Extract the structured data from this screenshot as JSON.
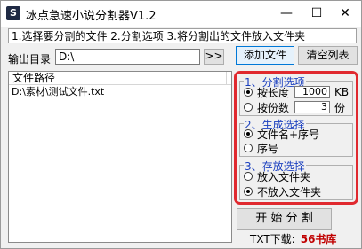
{
  "window": {
    "title": "冰点急速小说分割器V1.2",
    "icon_glyph": "S",
    "minimize": "—",
    "maximize": "☐",
    "close": "✕"
  },
  "tip": "1.选择要分割的文件 2.分割选项 3.将分割出的文件放入文件夹",
  "output": {
    "label": "输出目录",
    "value": "D:\\",
    "browse_label": ">>"
  },
  "toolbar": {
    "add_file_label": "添加文件",
    "clear_list_label": "清空列表"
  },
  "file_list": {
    "column_header": "文件路径",
    "rows": [
      "D:\\素材\\测试文件.txt"
    ]
  },
  "split_options": {
    "title": "1、分割选项",
    "by_length_label": "按长度",
    "by_length_value": "1000",
    "by_length_unit": "KB",
    "by_length_selected": true,
    "by_count_label": "按份数",
    "by_count_value": "3",
    "by_count_unit": "份",
    "by_count_selected": false
  },
  "generate_options": {
    "title": "2、生成选择",
    "filename_plus_seq_label": "文件名+序号",
    "filename_plus_seq_selected": true,
    "seq_label": "序号",
    "seq_selected": false
  },
  "store_options": {
    "title": "3、存放选择",
    "into_folder_label": "放入文件夹",
    "into_folder_selected": false,
    "not_into_folder_label": "不放入文件夹",
    "not_into_folder_selected": true
  },
  "start_button_label": "开 始 分 割",
  "footer": {
    "txt_download_label": "TXT下载:",
    "brand": "56书库"
  },
  "colors": {
    "highlight_border": "#e0292f",
    "group_title": "#1a3fbf",
    "brand": "#c00000"
  }
}
